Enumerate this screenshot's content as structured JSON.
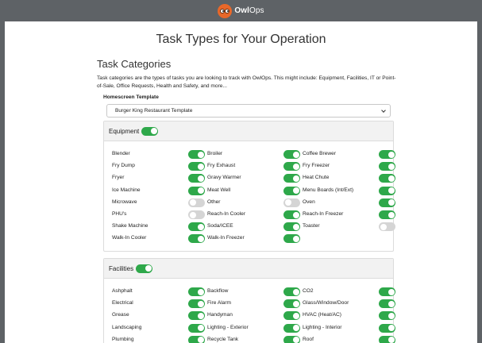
{
  "brand": {
    "name_bold": "Owl",
    "name_rest": "Ops"
  },
  "page_title": "Task Types for Your Operation",
  "section": {
    "title": "Task Categories",
    "description": "Task categories are the types of tasks you are looking to track with OwlOps. This might include: Equipment, Facilities, IT or Point-of-Sale, Office Requests, Health and Safety, and more..."
  },
  "template": {
    "label": "Homescreen Template",
    "value": "Burger King Restaurant Template"
  },
  "colors": {
    "toggle_on": "#2ea84a",
    "toggle_off": "#d5d5d5",
    "brand": "#e8682a",
    "topbar": "#5e6266"
  },
  "categories": [
    {
      "title": "Equipment",
      "enabled": true,
      "items": [
        {
          "label": "Blender",
          "on": true
        },
        {
          "label": "Broiler",
          "on": true
        },
        {
          "label": "Coffee Brewer",
          "on": true
        },
        {
          "label": "Fry Dump",
          "on": true
        },
        {
          "label": "Fry Exhaust",
          "on": true
        },
        {
          "label": "Fry Freezer",
          "on": true
        },
        {
          "label": "Fryer",
          "on": true
        },
        {
          "label": "Gravy Warmer",
          "on": true
        },
        {
          "label": "Heat Chute",
          "on": true
        },
        {
          "label": "Ice Machine",
          "on": true
        },
        {
          "label": "Meat Well",
          "on": true
        },
        {
          "label": "Menu Boards (Int/Ext)",
          "on": true
        },
        {
          "label": "Microwave",
          "on": false
        },
        {
          "label": "Other",
          "on": false
        },
        {
          "label": "Oven",
          "on": true
        },
        {
          "label": "PHU's",
          "on": false
        },
        {
          "label": "Reach-In Cooler",
          "on": true
        },
        {
          "label": "Reach-In Freezer",
          "on": true
        },
        {
          "label": "Shake Machine",
          "on": true
        },
        {
          "label": "Soda/ICEE",
          "on": true
        },
        {
          "label": "Toaster",
          "on": false
        },
        {
          "label": "Walk-In Cooler",
          "on": true
        },
        {
          "label": "Walk-In Freezer",
          "on": true
        }
      ]
    },
    {
      "title": "Facilities",
      "enabled": true,
      "items": [
        {
          "label": "Ashphalt",
          "on": true
        },
        {
          "label": "Backflow",
          "on": true
        },
        {
          "label": "CO2",
          "on": true
        },
        {
          "label": "Electrical",
          "on": true
        },
        {
          "label": "Fire Alarm",
          "on": true
        },
        {
          "label": "Glass/Window/Door",
          "on": true
        },
        {
          "label": "Grease",
          "on": true
        },
        {
          "label": "Handyman",
          "on": true
        },
        {
          "label": "HVAC (Heat/AC)",
          "on": true
        },
        {
          "label": "Landscaping",
          "on": true
        },
        {
          "label": "Lighting - Exterior",
          "on": true
        },
        {
          "label": "Lighting - Interior",
          "on": true
        },
        {
          "label": "Plumbing",
          "on": true
        },
        {
          "label": "Recycle Tank",
          "on": true
        },
        {
          "label": "Roof",
          "on": true
        }
      ]
    }
  ]
}
